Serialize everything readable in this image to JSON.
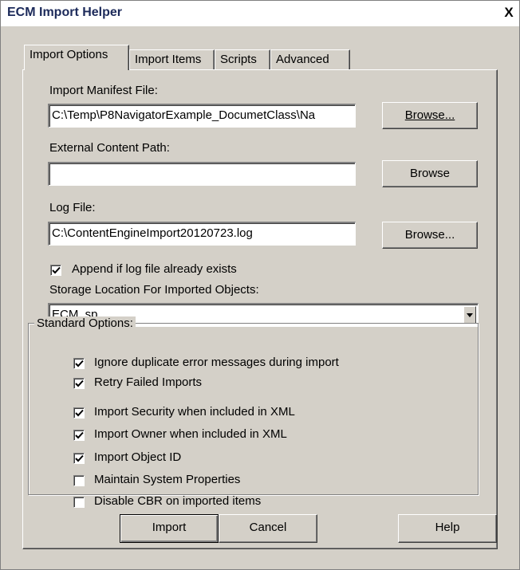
{
  "window": {
    "title": "ECM Import Helper",
    "close_glyph": "X"
  },
  "tabs": [
    {
      "label": "Import Options",
      "active": true
    },
    {
      "label": "Import Items",
      "active": false
    },
    {
      "label": "Scripts",
      "active": false
    },
    {
      "label": "Advanced",
      "active": false
    }
  ],
  "manifest": {
    "label": "Import Manifest File:",
    "value": "C:\\Temp\\P8NavigatorExample_DocumetClass\\Na",
    "browse_label": "Browse..."
  },
  "external": {
    "label": "External Content Path:",
    "value": "",
    "browse_label": "Browse"
  },
  "logfile": {
    "label": "Log File:",
    "value": "C:\\ContentEngineImport20120723.log",
    "browse_label": "Browse..."
  },
  "append": {
    "label": "Append if log file already exists",
    "checked": true
  },
  "storage": {
    "label": "Storage Location For Imported Objects:",
    "value": "ECM_sp"
  },
  "standard_options": {
    "legend": "Standard Options:",
    "items": [
      {
        "label": "Ignore duplicate error messages during import",
        "checked": true
      },
      {
        "label": "Retry Failed Imports",
        "checked": true
      },
      {
        "label": "Import Security when included in XML",
        "checked": true
      },
      {
        "label": "Import Owner when included in XML",
        "checked": true
      },
      {
        "label": "Import Object ID",
        "checked": true
      },
      {
        "label": "Maintain System Properties",
        "checked": false
      },
      {
        "label": "Disable CBR on imported items",
        "checked": false
      }
    ]
  },
  "footer": {
    "import_label": "Import",
    "cancel_label": "Cancel",
    "help_label": "Help"
  },
  "icons": {
    "checkmark": "check-icon",
    "dropdown": "chevron-down-icon",
    "close": "close-icon"
  }
}
